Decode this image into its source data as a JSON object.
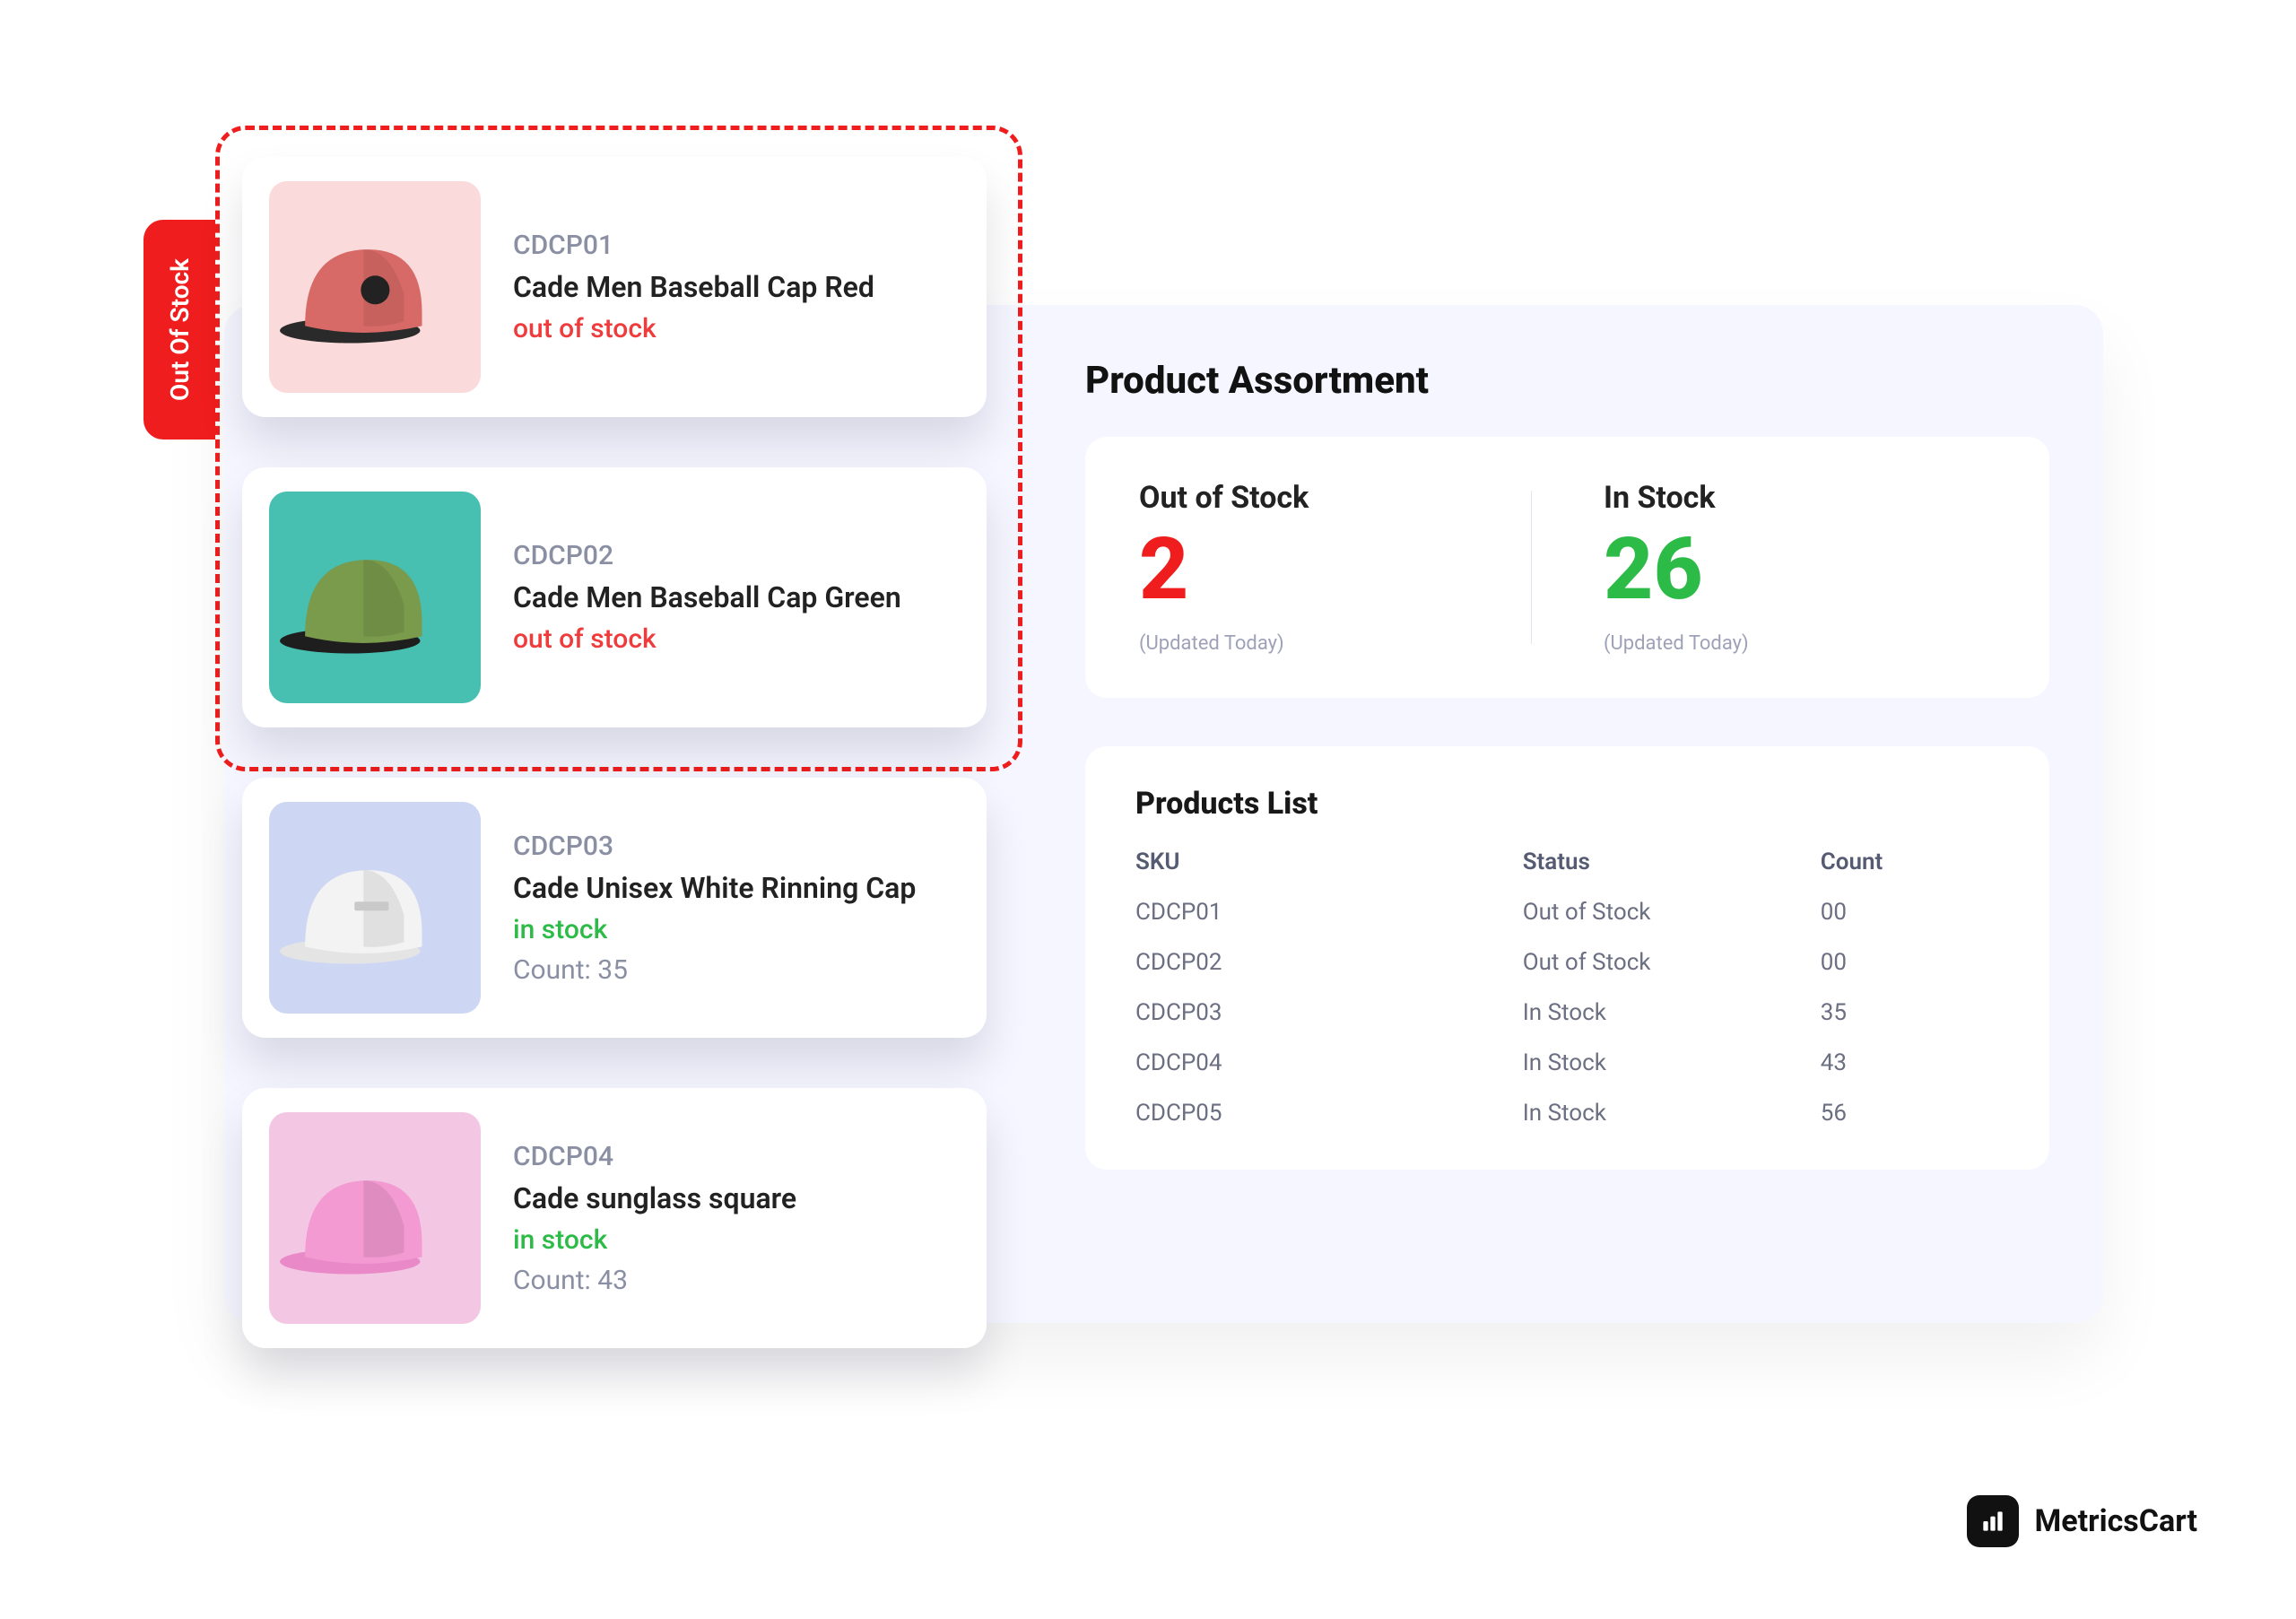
{
  "sidetab": {
    "label": "Out Of Stock"
  },
  "assortment": {
    "title": "Product Assortment",
    "out": {
      "label": "Out of Stock",
      "value": "2",
      "sub": "(Updated Today)"
    },
    "in": {
      "label": "In Stock",
      "value": "26",
      "sub": "(Updated Today)"
    }
  },
  "list": {
    "title": "Products List",
    "headers": {
      "sku": "SKU",
      "status": "Status",
      "count": "Count"
    },
    "rows": [
      {
        "sku": "CDCP01",
        "status": "Out of Stock",
        "status_kind": "out",
        "count": "00"
      },
      {
        "sku": "CDCP02",
        "status": "Out of Stock",
        "status_kind": "out",
        "count": "00"
      },
      {
        "sku": "CDCP03",
        "status": "In Stock",
        "status_kind": "in",
        "count": "35"
      },
      {
        "sku": "CDCP04",
        "status": "In Stock",
        "status_kind": "in",
        "count": "43"
      },
      {
        "sku": "CDCP05",
        "status": "In Stock",
        "status_kind": "in",
        "count": "56"
      }
    ]
  },
  "cards": [
    {
      "sku": "CDCP01",
      "name": "Cade Men Baseball Cap Red",
      "status": "out of stock",
      "status_kind": "out",
      "count": null,
      "thumb": "red",
      "icon": "cap-red"
    },
    {
      "sku": "CDCP02",
      "name": "Cade Men Baseball Cap Green",
      "status": "out of stock",
      "status_kind": "out",
      "count": null,
      "thumb": "teal",
      "icon": "cap-green"
    },
    {
      "sku": "CDCP03",
      "name": "Cade Unisex White Rinning Cap",
      "status": "in stock",
      "status_kind": "in",
      "count": "Count: 35",
      "thumb": "blue",
      "icon": "cap-white"
    },
    {
      "sku": "CDCP04",
      "name": "Cade sunglass square",
      "status": "in stock",
      "status_kind": "in",
      "count": "Count: 43",
      "thumb": "pink",
      "icon": "cap-pink"
    }
  ],
  "brand": {
    "name": "MetricsCart",
    "icon": "bar-chart-icon"
  },
  "colors": {
    "accent_red": "#ef1d1d",
    "accent_green": "#2dbb47",
    "panel_bg": "#f5f6ff"
  }
}
